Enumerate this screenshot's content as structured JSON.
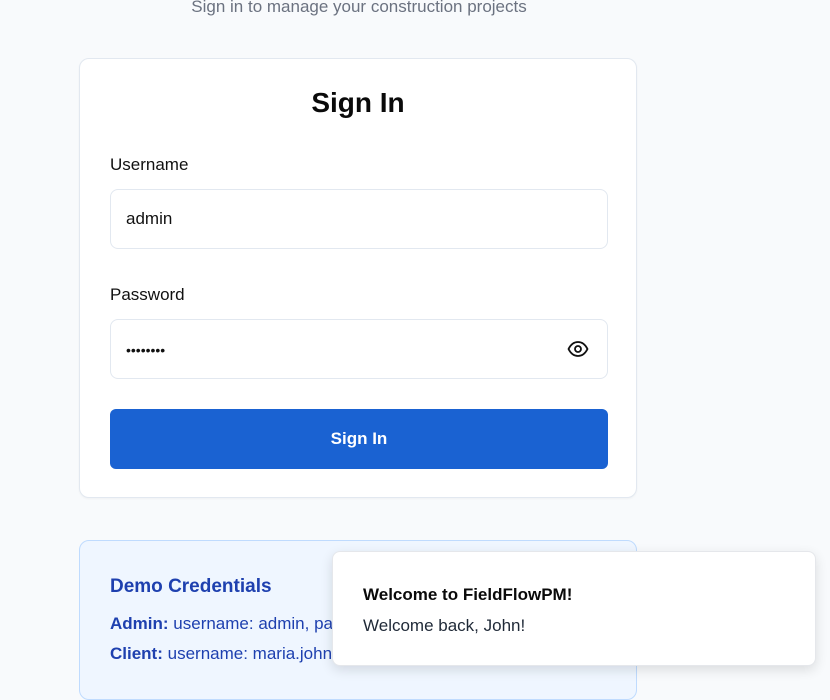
{
  "header": {
    "subtitle": "Sign in to manage your construction projects"
  },
  "signin_card": {
    "title": "Sign In",
    "username_label": "Username",
    "username_value": "admin",
    "password_label": "Password",
    "password_value": "••••••••",
    "password_toggle_icon": "eye-icon",
    "submit_label": "Sign In"
  },
  "demo_credentials": {
    "title": "Demo Credentials",
    "admin_label": "Admin:",
    "admin_text": "username: admin, pa",
    "client_label": "Client:",
    "client_text": "username: maria.john"
  },
  "toast": {
    "title": "Welcome to FieldFlowPM!",
    "message": "Welcome back, John!"
  },
  "colors": {
    "primary": "#1a62d2",
    "background": "#f8fafc",
    "demo_bg": "#eff6ff",
    "demo_text": "#1e40af"
  }
}
